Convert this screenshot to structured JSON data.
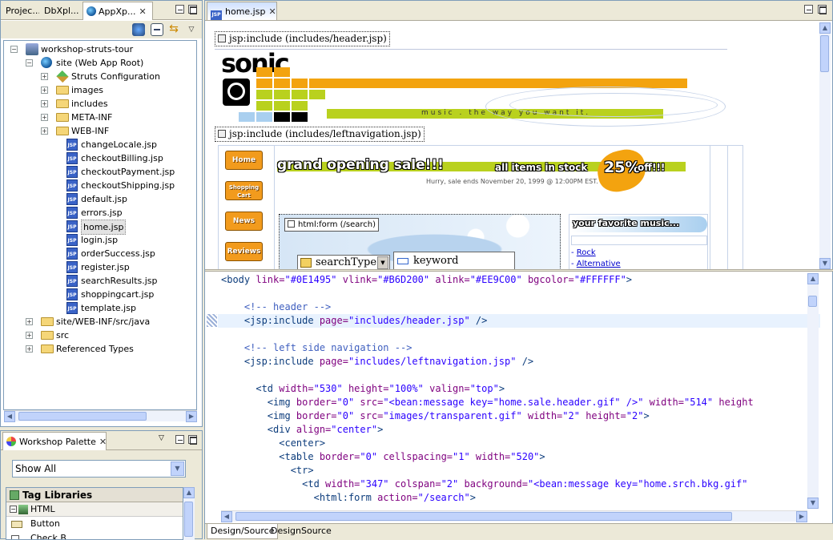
{
  "left_panel": {
    "tabs": [
      "Projec...",
      "DbXpl...",
      "AppXp..."
    ],
    "tree": [
      {
        "label": "workshop-struts-tour",
        "indent": 0,
        "expand": "−",
        "icon": "project"
      },
      {
        "label": "site (Web App Root)",
        "indent": 1,
        "expand": "−",
        "icon": "globe"
      },
      {
        "label": "Struts Configuration",
        "indent": 2,
        "expand": "+",
        "icon": "struts"
      },
      {
        "label": "images",
        "indent": 2,
        "expand": "+",
        "icon": "folder"
      },
      {
        "label": "includes",
        "indent": 2,
        "expand": "+",
        "icon": "folder"
      },
      {
        "label": "META-INF",
        "indent": 2,
        "expand": "+",
        "icon": "folder"
      },
      {
        "label": "WEB-INF",
        "indent": 2,
        "expand": "+",
        "icon": "folder"
      },
      {
        "label": "changeLocale.jsp",
        "indent": 2,
        "expand": "",
        "icon": "jsp"
      },
      {
        "label": "checkoutBilling.jsp",
        "indent": 2,
        "expand": "",
        "icon": "jsp"
      },
      {
        "label": "checkoutPayment.jsp",
        "indent": 2,
        "expand": "",
        "icon": "jsp"
      },
      {
        "label": "checkoutShipping.jsp",
        "indent": 2,
        "expand": "",
        "icon": "jsp"
      },
      {
        "label": "default.jsp",
        "indent": 2,
        "expand": "",
        "icon": "jsp"
      },
      {
        "label": "errors.jsp",
        "indent": 2,
        "expand": "",
        "icon": "jsp"
      },
      {
        "label": "home.jsp",
        "indent": 2,
        "expand": "",
        "icon": "jsp",
        "selected": true
      },
      {
        "label": "login.jsp",
        "indent": 2,
        "expand": "",
        "icon": "jsp"
      },
      {
        "label": "orderSuccess.jsp",
        "indent": 2,
        "expand": "",
        "icon": "jsp"
      },
      {
        "label": "register.jsp",
        "indent": 2,
        "expand": "",
        "icon": "jsp"
      },
      {
        "label": "searchResults.jsp",
        "indent": 2,
        "expand": "",
        "icon": "jsp"
      },
      {
        "label": "shoppingcart.jsp",
        "indent": 2,
        "expand": "",
        "icon": "jsp"
      },
      {
        "label": "template.jsp",
        "indent": 2,
        "expand": "",
        "icon": "jsp"
      },
      {
        "label": "site/WEB-INF/src/java",
        "indent": 1,
        "expand": "+",
        "icon": "folder"
      },
      {
        "label": "src",
        "indent": 1,
        "expand": "+",
        "icon": "folder"
      },
      {
        "label": "Referenced Types",
        "indent": 1,
        "expand": "+",
        "icon": "folder"
      }
    ]
  },
  "palette": {
    "title": "Workshop Palette",
    "filter": "Show All",
    "section": "Tag Libraries",
    "subsection": "HTML",
    "items": [
      "Button",
      "Check B..."
    ]
  },
  "editor": {
    "tab": "home.jsp",
    "include_header": "jsp:include (includes/header.jsp)",
    "include_leftnav": "jsp:include (includes/leftnavigation.jsp)",
    "logo": "sonic",
    "tagline": "music . the  way  you  want  it.",
    "nav": [
      "Home",
      "Shopping Cart",
      "News",
      "Reviews"
    ],
    "sale_banner": "grand opening sale!!!",
    "sale_stock": "all items in stock",
    "sale_percent": "25%",
    "sale_off": "off!!!",
    "sale_ends": "Hurry, sale ends November 20, 1999 @ 12:00PM EST.",
    "form_tag": "html:form (/search)",
    "search_type": "searchType",
    "keyword": "keyword",
    "favorite": "your favorite music...",
    "genres": [
      "Rock",
      "Alternative"
    ],
    "code": [
      [
        [
          "t",
          "<body "
        ],
        [
          "a",
          "link="
        ],
        [
          "v",
          "\"#0E1495\""
        ],
        [
          "a",
          " vlink="
        ],
        [
          "v",
          "\"#B6D200\""
        ],
        [
          "a",
          " alink="
        ],
        [
          "v",
          "\"#EE9C00\""
        ],
        [
          "a",
          " bgcolor="
        ],
        [
          "v",
          "\"#FFFFFF\""
        ],
        [
          "t",
          ">"
        ]
      ],
      [],
      [
        [
          "c",
          "    <!-- header -->"
        ]
      ],
      [
        [
          "t",
          "    <jsp:include "
        ],
        [
          "a",
          "page="
        ],
        [
          "v",
          "\"includes/header.jsp\""
        ],
        [
          "t",
          " />"
        ]
      ],
      [],
      [
        [
          "c",
          "    <!-- left side navigation -->"
        ]
      ],
      [
        [
          "t",
          "    <jsp:include "
        ],
        [
          "a",
          "page="
        ],
        [
          "v",
          "\"includes/leftnavigation.jsp\""
        ],
        [
          "t",
          " />"
        ]
      ],
      [],
      [
        [
          "t",
          "      <td "
        ],
        [
          "a",
          "width="
        ],
        [
          "v",
          "\"530\""
        ],
        [
          "a",
          " height="
        ],
        [
          "v",
          "\"100%\""
        ],
        [
          "a",
          " valign="
        ],
        [
          "v",
          "\"top\""
        ],
        [
          "t",
          ">"
        ]
      ],
      [
        [
          "t",
          "        <img "
        ],
        [
          "a",
          "border="
        ],
        [
          "v",
          "\"0\""
        ],
        [
          "a",
          " src="
        ],
        [
          "v",
          "\"<bean:message key=\"home.sale.header.gif\" />\""
        ],
        [
          "a",
          " width="
        ],
        [
          "v",
          "\"514\""
        ],
        [
          "a",
          " height"
        ]
      ],
      [
        [
          "t",
          "        <img "
        ],
        [
          "a",
          "border="
        ],
        [
          "v",
          "\"0\""
        ],
        [
          "a",
          " src="
        ],
        [
          "v",
          "\"images/transparent.gif\""
        ],
        [
          "a",
          " width="
        ],
        [
          "v",
          "\"2\""
        ],
        [
          "a",
          " height="
        ],
        [
          "v",
          "\"2\""
        ],
        [
          "t",
          ">"
        ]
      ],
      [
        [
          "t",
          "        <div "
        ],
        [
          "a",
          "align="
        ],
        [
          "v",
          "\"center\""
        ],
        [
          "t",
          ">"
        ]
      ],
      [
        [
          "t",
          "          <center>"
        ]
      ],
      [
        [
          "t",
          "          <table "
        ],
        [
          "a",
          "border="
        ],
        [
          "v",
          "\"0\""
        ],
        [
          "a",
          " cellspacing="
        ],
        [
          "v",
          "\"1\""
        ],
        [
          "a",
          " width="
        ],
        [
          "v",
          "\"520\""
        ],
        [
          "t",
          ">"
        ]
      ],
      [
        [
          "t",
          "            <tr>"
        ]
      ],
      [
        [
          "t",
          "              <td "
        ],
        [
          "a",
          "width="
        ],
        [
          "v",
          "\"347\""
        ],
        [
          "a",
          " colspan="
        ],
        [
          "v",
          "\"2\""
        ],
        [
          "a",
          " background="
        ],
        [
          "v",
          "\"<bean:message key=\"home.srch.bkg.gif\""
        ]
      ],
      [
        [
          "t",
          "                <html:form "
        ],
        [
          "a",
          "action="
        ],
        [
          "v",
          "\"/search\""
        ],
        [
          "t",
          ">"
        ]
      ]
    ],
    "bottom_tabs": [
      "Design/Source",
      "Design",
      "Source"
    ]
  }
}
